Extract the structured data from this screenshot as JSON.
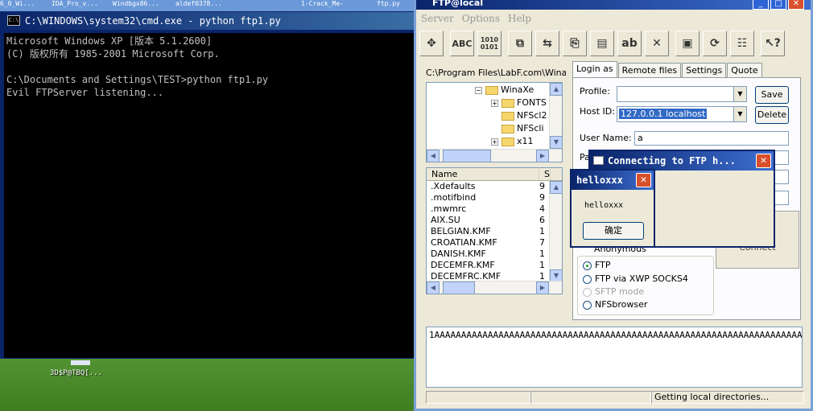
{
  "taskbar": {
    "items": [
      "6_0_Wi...",
      "IDA_Pro_v...",
      "Windbgx86...",
      "aldef0378...",
      "1-Crack_Me-",
      "ftp.py"
    ]
  },
  "desktop": {
    "icon_label": "3D$P@TBQ[..."
  },
  "cmd": {
    "icon": "C:\\",
    "title": "C:\\WINDOWS\\system32\\cmd.exe - python ftp1.py",
    "lines": [
      "Microsoft Windows XP [版本 5.1.2600]",
      "(C) 版权所有 1985-2001 Microsoft Corp.",
      "",
      "C:\\Documents and Settings\\TEST>python ftp1.py",
      "Evil FTPServer listening..."
    ]
  },
  "ftp": {
    "title": "FTP@local",
    "menu": [
      "Server",
      "Options",
      "Help"
    ],
    "toolbar": {
      "abc": "ABC",
      "binary": "1010 0101"
    },
    "local_path": "C:\\Program Files\\LabF.com\\WinaXe",
    "tree": [
      "WinaXe",
      "FONTS",
      "NFScl2",
      "NFScli",
      "x11"
    ],
    "file_list": {
      "columns": [
        "Name",
        "S"
      ],
      "rows": [
        {
          "name": ".Xdefaults",
          "size": "9"
        },
        {
          "name": ".motifbind",
          "size": "9"
        },
        {
          "name": ".mwmrc",
          "size": "4"
        },
        {
          "name": "AIX.SU",
          "size": "6"
        },
        {
          "name": "BELGIAN.KMF",
          "size": "1"
        },
        {
          "name": "CROATIAN.KMF",
          "size": "7"
        },
        {
          "name": "DANISH.KMF",
          "size": "1"
        },
        {
          "name": "DECEMFR.KMF",
          "size": "1"
        },
        {
          "name": "DECEMFRC.KMF",
          "size": "1"
        }
      ]
    },
    "tabs": [
      "Login as",
      "Remote files",
      "Settings",
      "Quote"
    ],
    "login": {
      "profile_label": "Profile:",
      "profile_value": "",
      "save_label": "Save",
      "host_label": "Host ID:",
      "host_value": "127.0.0.1 localhost",
      "delete_label": "Delete",
      "user_label": "User Name:",
      "user_value": "a",
      "password_label_partial": "Pa",
      "host_fragment": "ost",
      "anonymous_label": "Anonymous",
      "connect_label": "Connect"
    },
    "protocols": {
      "ftp": "FTP",
      "ftp_socks": "FTP via XWP SOCKS4",
      "sftp": "SFTP mode",
      "nfs": "NFSbrowser",
      "selected": "FTP"
    },
    "log_text": "1AAAAAAAAAAAAAAAAAAAAAAAAAAAAAAAAAAAAAAAAAAAAAAAAAAAAAAAAAAAAAAAAAAAAAAAAAAAAAAAAAAAAAAAAAAA",
    "status": [
      "",
      "",
      "Getting local directories..."
    ]
  },
  "connect_dialog": {
    "title": "Connecting to FTP h..."
  },
  "hello_dialog": {
    "title": "helloxxx",
    "message": "helloxxx",
    "ok_label": "确定"
  }
}
